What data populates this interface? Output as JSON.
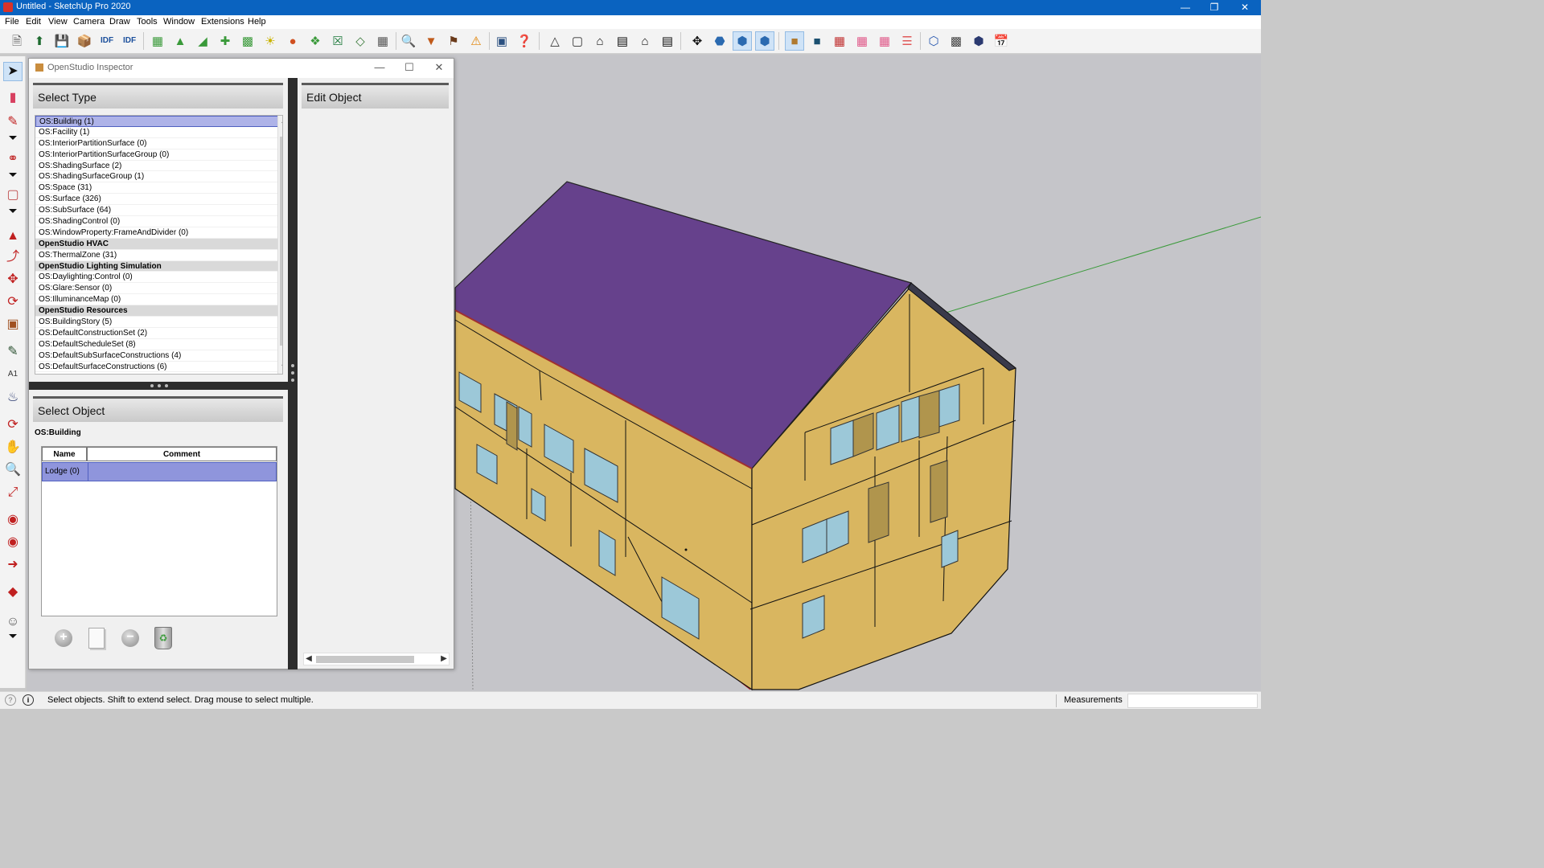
{
  "window": {
    "title": "Untitled - SketchUp Pro 2020",
    "minimize": "—",
    "maximize": "❐",
    "close": "✕"
  },
  "menu": [
    "File",
    "Edit",
    "View",
    "Camera",
    "Draw",
    "Tools",
    "Window",
    "Extensions",
    "Help"
  ],
  "inspector": {
    "title": "OpenStudio Inspector",
    "minimize": "—",
    "maximize": "☐",
    "close": "✕",
    "select_type": {
      "header": "Select Type",
      "items": [
        {
          "label": "OS:Building (1)",
          "selected": true
        },
        {
          "label": "OS:Facility (1)"
        },
        {
          "label": "OS:InteriorPartitionSurface (0)"
        },
        {
          "label": "OS:InteriorPartitionSurfaceGroup (0)"
        },
        {
          "label": "OS:ShadingSurface (2)"
        },
        {
          "label": "OS:ShadingSurfaceGroup (1)"
        },
        {
          "label": "OS:Space (31)"
        },
        {
          "label": "OS:Surface (326)"
        },
        {
          "label": "OS:SubSurface (64)"
        },
        {
          "label": "OS:ShadingControl (0)"
        },
        {
          "label": "OS:WindowProperty:FrameAndDivider (0)"
        },
        {
          "label": "OpenStudio HVAC",
          "group": true
        },
        {
          "label": "OS:ThermalZone (31)"
        },
        {
          "label": "OpenStudio Lighting Simulation",
          "group": true
        },
        {
          "label": "OS:Daylighting:Control (0)"
        },
        {
          "label": "OS:Glare:Sensor (0)"
        },
        {
          "label": "OS:IlluminanceMap (0)"
        },
        {
          "label": "OpenStudio Resources",
          "group": true
        },
        {
          "label": "OS:BuildingStory (5)"
        },
        {
          "label": "OS:DefaultConstructionSet (2)"
        },
        {
          "label": "OS:DefaultScheduleSet (8)"
        },
        {
          "label": "OS:DefaultSubSurfaceConstructions (4)"
        },
        {
          "label": "OS:DefaultSurfaceConstructions (6)"
        }
      ],
      "scroll_up": "▲",
      "scroll_down": "▼"
    },
    "select_object": {
      "header": "Select Object",
      "class_label": "OS:Building",
      "columns": [
        "Name",
        "Comment"
      ],
      "rows": [
        {
          "name": "Lodge (0)",
          "comment": ""
        }
      ],
      "buttons": {
        "add": "+",
        "copy": "",
        "remove": "−"
      }
    },
    "edit_object": {
      "header": "Edit Object",
      "scroll_left": "◀",
      "scroll_right": "▶"
    }
  },
  "statusbar": {
    "message": "Select objects. Shift to extend select. Drag mouse to select multiple.",
    "measurements_label": "Measurements",
    "info_icon": "i",
    "help_icon": "?"
  },
  "colors": {
    "accent": "#0a63c0",
    "roof": "#66418c",
    "wall": "#d9b660",
    "glass": "#9cc8d8",
    "door": "#b0954d",
    "selection": "#aeb3e8",
    "axis_green": "#3a9a3a",
    "axis_red": "#c02020"
  },
  "icons": {
    "toolbar": [
      "new-model-icon",
      "open-icon",
      "save-icon",
      "import-icon",
      "export-idf-icon",
      "export-idf2-icon",
      "space-icon",
      "shading-icon",
      "interior-partition-icon",
      "daylighting-icon",
      "illuminance-icon",
      "luminaire-icon",
      "glare-sensor-icon",
      "surface-matching-icon",
      "spreadsheet-icon",
      "hide-others-icon",
      "grid-icon",
      "search-icon",
      "filter-icon",
      "info-tool-icon",
      "warning-icon",
      "inspector-icon",
      "help-icon",
      "top-view-icon",
      "front-view-icon",
      "home-view-icon",
      "right-view-icon",
      "back-view-icon",
      "left-view-icon",
      "orbit-icon",
      "xray-icon",
      "wireframe-icon",
      "shaded-icon",
      "render-by-class-icon",
      "render-by-boundary-icon",
      "render-by-construction-icon",
      "render-by-space-type-icon",
      "render-by-zone-icon",
      "render-by-story-icon",
      "render-by-data-icon",
      "render-hidden-line-icon",
      "render-monochrome-icon",
      "schedule-icon"
    ],
    "left": [
      "select-icon",
      "eraser-icon",
      "line-icon",
      "arc-icon",
      "rectangle-icon",
      "push-pull-icon",
      "follow-me-icon",
      "move-icon",
      "rotate-icon",
      "scale-icon",
      "tape-measure-icon",
      "text-icon",
      "paint-bucket-icon",
      "orbit-icon",
      "pan-icon",
      "zoom-icon",
      "zoom-extents-icon",
      "warehouse-icon",
      "extension-warehouse-icon",
      "send-to-layout-icon",
      "ruby-icon",
      "account-icon"
    ]
  }
}
